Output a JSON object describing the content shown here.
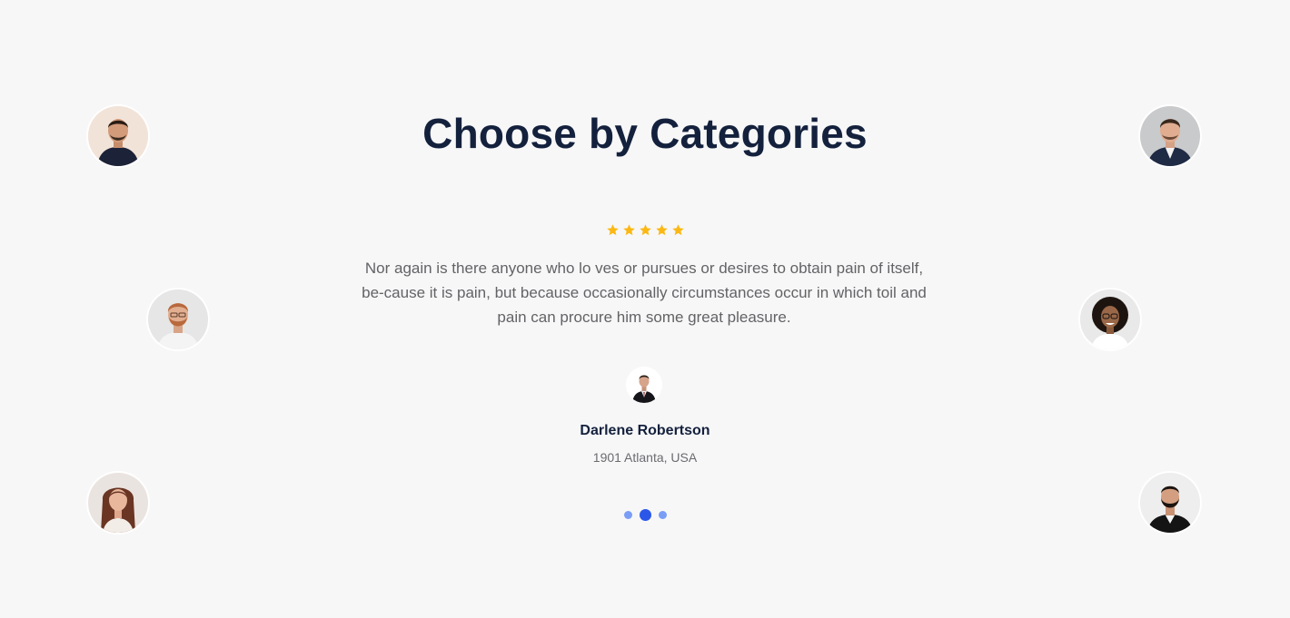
{
  "section": {
    "title": "Choose by Categories"
  },
  "testimonial": {
    "rating": 5,
    "quote": "Nor again is there anyone who lo ves or pursues or desires to obtain pain of itself, be-cause it is pain, but because occasionally circumstances occur in which toil and pain can procure him some great pleasure.",
    "author_name": "Darlene Robertson",
    "author_location": "1901 Atlanta, USA"
  },
  "slider": {
    "dot_count": 3,
    "active_index": 1
  },
  "colors": {
    "background": "#f7f7f8",
    "heading": "#14213d",
    "body_text": "#636366",
    "star": "#fbb814",
    "dot_active": "#2b57e8",
    "dot_inactive": "#7a9ef5"
  },
  "icons": {
    "star": "star-icon"
  }
}
